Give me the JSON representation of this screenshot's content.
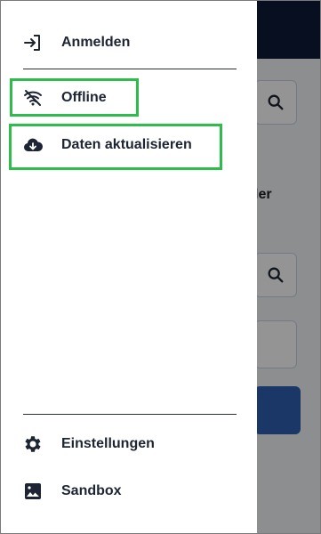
{
  "drawer": {
    "items_top": [
      {
        "label": "Anmelden",
        "icon": "login-icon"
      },
      {
        "label": "Offline",
        "icon": "wifi-off-icon"
      },
      {
        "label": "Daten aktualisieren",
        "icon": "cloud-download-icon"
      }
    ],
    "items_bottom": [
      {
        "label": "Einstellungen",
        "icon": "gear-icon"
      },
      {
        "label": "Sandbox",
        "icon": "image-icon"
      }
    ]
  },
  "background_app": {
    "partial_text": "ler"
  },
  "colors": {
    "highlight": "#2ebd4a",
    "topbar": "#0f1a3a",
    "primary_button": "#2f5fb3",
    "text": "#1d2433"
  }
}
